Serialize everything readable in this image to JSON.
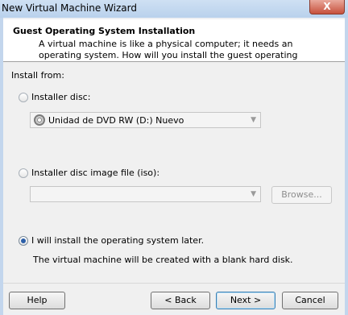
{
  "window": {
    "title": "New Virtual Machine Wizard",
    "close_label": "X"
  },
  "header": {
    "heading": "Guest Operating System Installation",
    "description": "A virtual machine is like a physical computer; it needs an operating system. How will you install the guest operating system?"
  },
  "install_from": {
    "label": "Install from:",
    "installer_disc": {
      "label": "Installer disc:",
      "selected": false,
      "drive_value": "Unidad de DVD RW (D:) Nuevo"
    },
    "iso": {
      "label": "Installer disc image file (iso):",
      "selected": false,
      "path_value": "",
      "browse_label": "Browse..."
    },
    "later": {
      "label": "I will install the operating system later.",
      "selected": true,
      "note": "The virtual machine will be created with a blank hard disk."
    }
  },
  "buttons": {
    "help": "Help",
    "back": "< Back",
    "next": "Next >",
    "cancel": "Cancel"
  }
}
